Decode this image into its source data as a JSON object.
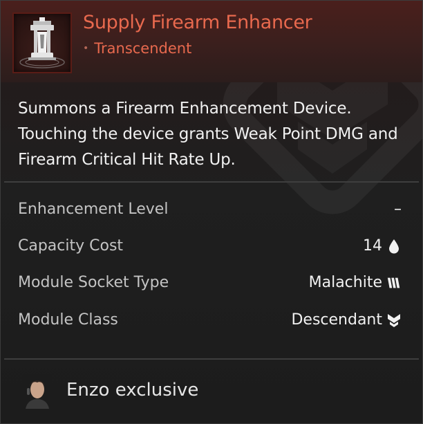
{
  "item": {
    "icon_name": "firearm-enhancement-device-icon",
    "name": "Supply Firearm Enhancer",
    "rarity_dot": "•",
    "rarity": "Transcendent",
    "description": "Summons a Firearm Enhancement Device. Touching the device grants Weak Point DMG and Firearm Critical Hit Rate Up."
  },
  "stats": [
    {
      "label": "Enhancement Level",
      "value": "–",
      "icon": ""
    },
    {
      "label": "Capacity Cost",
      "value": "14",
      "icon": "capacity-drop-icon"
    },
    {
      "label": "Module Socket Type",
      "value": "Malachite",
      "icon": "malachite-socket-icon"
    },
    {
      "label": "Module Class",
      "value": "Descendant",
      "icon": "descendant-class-icon"
    }
  ],
  "footer": {
    "avatar_icon": "enzo-portrait-icon",
    "text": "Enzo exclusive"
  },
  "colors": {
    "rarity": "#e8694e",
    "icon_border": "#5a1c16",
    "panel": "#1f1f1f",
    "header": "#3a1f1d"
  }
}
